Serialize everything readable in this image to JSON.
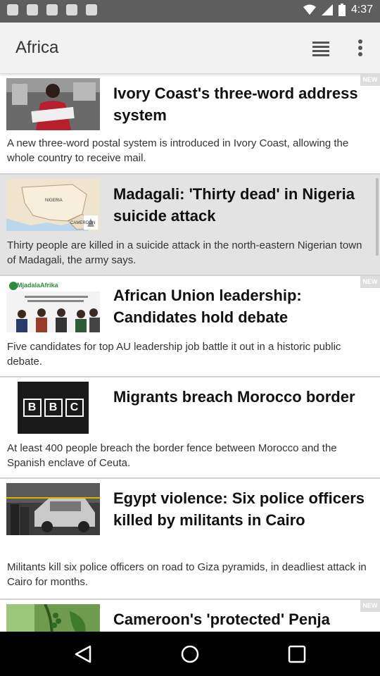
{
  "status_bar": {
    "time": "4:37",
    "icons_left": [
      "image-icon",
      "image-icon",
      "bag-icon",
      "bag-icon",
      "bag-icon"
    ]
  },
  "toolbar": {
    "title": "Africa"
  },
  "articles": [
    {
      "headline": "Ivory Coast's three-word address system",
      "summary": "A new three-word postal system is introduced in Ivory Coast, allowing the whole country to receive mail.",
      "badge": "NEW",
      "thumb": "woman-sorting-mail"
    },
    {
      "headline": "Madagali: 'Thirty dead' in Nigeria suicide attack",
      "summary": "Thirty people are killed in a suicide attack in the north-eastern Nigerian town of Madagali, the army says.",
      "badge": "",
      "thumb": "nigeria-map",
      "map_labels": [
        "NIGERIA",
        "CAMEROON"
      ]
    },
    {
      "headline": "African Union leadership: Candidates hold debate",
      "summary": "Five candidates for top AU leadership job battle it out in a historic public debate.",
      "badge": "NEW",
      "thumb": "mjadala-afrika",
      "thumb_text": "MjadalaAfrika"
    },
    {
      "headline": "Migrants breach Morocco border",
      "summary": "At least 400 people breach the border fence between Morocco and the Spanish enclave of Ceuta.",
      "badge": "",
      "thumb": "bbc-logo",
      "logo_letters": [
        "B",
        "B",
        "C"
      ]
    },
    {
      "headline": "Egypt violence: Six police officers killed by militants in Cairo",
      "summary": "Militants kill six police officers on road to Giza pyramids, in deadliest attack in Cairo for months.",
      "badge": "",
      "thumb": "damaged-police-vehicle"
    },
    {
      "headline": "Cameroon's 'protected' Penja",
      "summary": "",
      "badge": "NEW",
      "thumb": "pepper-plant"
    }
  ]
}
